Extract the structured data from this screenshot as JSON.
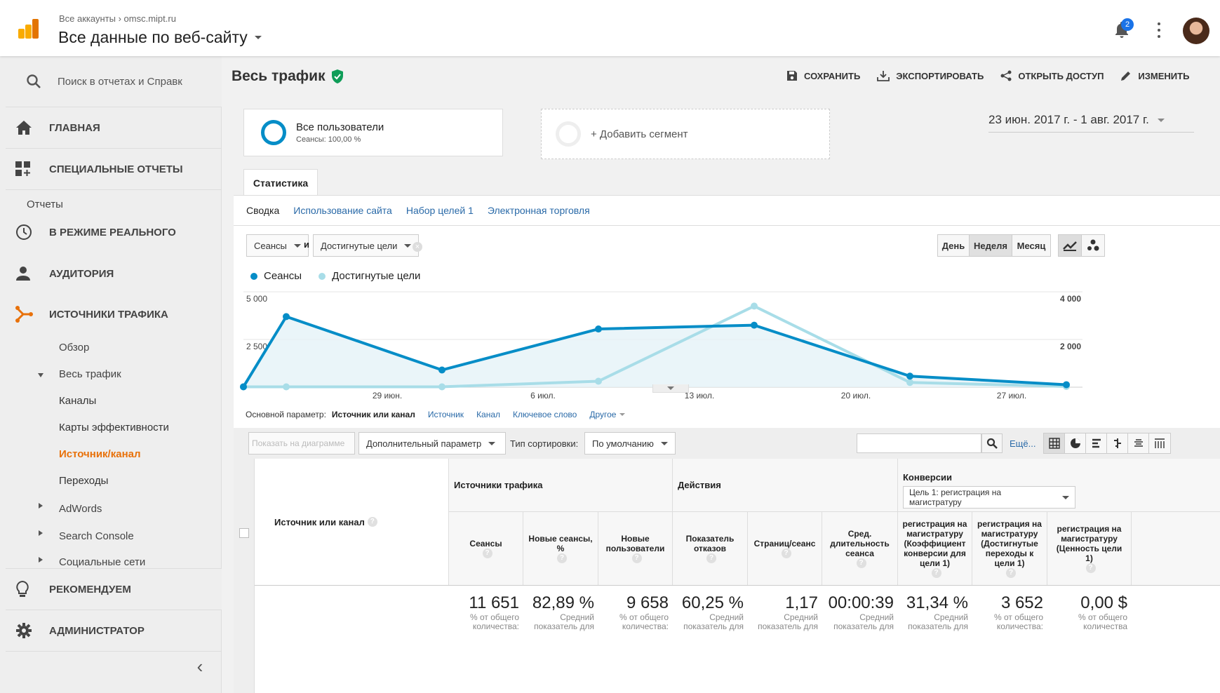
{
  "header": {
    "breadcrumb_root": "Все аккаунты",
    "breadcrumb_property": "omsc.mipt.ru",
    "view_title": "Все данные по веб-сайту",
    "notification_count": "2"
  },
  "sidebar": {
    "search_placeholder": "Поиск в отчетах и Справк",
    "home": "ГЛАВНАЯ",
    "custom_reports": "СПЕЦИАЛЬНЫЕ ОТЧЕТЫ",
    "reports_section": "Отчеты",
    "realtime": "В РЕЖИМЕ РЕАЛЬНОГО",
    "audience": "АУДИТОРИЯ",
    "acquisition": "ИСТОЧНИКИ ТРАФИКА",
    "overview": "Обзор",
    "all_traffic": "Весь трафик",
    "channels": "Каналы",
    "treemaps": "Карты эффективности",
    "source_medium": "Источник/канал",
    "referrals": "Переходы",
    "adwords": "AdWords",
    "search_console": "Search Console",
    "social": "Социальные сети",
    "discover": "РЕКОМЕНДУЕМ",
    "admin": "АДМИНИСТРАТОР",
    "collapse_glyph": "‹"
  },
  "report": {
    "title": "Весь трафик",
    "save": "СОХРАНИТЬ",
    "export": "ЭКСПОРТИРОВАТЬ",
    "share": "ОТКРЫТЬ ДОСТУП",
    "edit": "ИЗМЕНИТЬ",
    "date_range": "23 июн. 2017 г. - 1 авг. 2017 г.",
    "segment_name": "Все пользователи",
    "segment_sub": "Сеансы: 100,00 %",
    "add_segment": "+ Добавить сегмент",
    "tab_explorer": "Статистика",
    "subtabs": [
      "Сводка",
      "Использование сайта",
      "Набор целей 1",
      "Электронная торговля"
    ],
    "metric1": "Сеансы",
    "and_label": "и",
    "metric2": "Достигнутые цели",
    "period_day": "День",
    "period_week": "Неделя",
    "period_month": "Месяц"
  },
  "chart_data": {
    "type": "line",
    "x": [
      "23 июн.",
      "24 июн.",
      "29 июн.",
      "6 июл.",
      "13 июл.",
      "16 июл.",
      "20 июл.",
      "23 июл.",
      "27 июл.",
      "1 авг."
    ],
    "x_tick_labels": [
      "29 июн.",
      "6 июл.",
      "13 июл.",
      "20 июл.",
      "27 июл."
    ],
    "series": [
      {
        "name": "Сеансы",
        "axis": "left",
        "color": "#058dc7",
        "values": [
          20,
          3700,
          900,
          3050,
          null,
          3250,
          null,
          580,
          null,
          130
        ]
      },
      {
        "name": "Достигнутые цели",
        "axis": "right",
        "color": "#a8dde8",
        "values": [
          15,
          15,
          15,
          250,
          null,
          3400,
          null,
          200,
          null,
          30
        ]
      }
    ],
    "left_axis_ticks": [
      "5 000",
      "2 500"
    ],
    "right_axis_ticks": [
      "4 000",
      "2 000"
    ],
    "ylim_left": [
      0,
      5000
    ],
    "ylim_right": [
      0,
      4000
    ]
  },
  "table_controls": {
    "primary_dim_label": "Основной параметр:",
    "dims": [
      "Источник или канал",
      "Источник",
      "Канал",
      "Ключевое слово",
      "Другое"
    ],
    "plot_rows": "Показать на диаграмме",
    "secondary_dim": "Дополнительный параметр",
    "sort_type_label": "Тип сортировки:",
    "sort_default": "По умолчанию",
    "more": "Ещё..."
  },
  "table": {
    "dim_header": "Источник или канал",
    "group_acquisition": "Источники трафика",
    "group_behavior": "Действия",
    "group_conversions": "Конверсии",
    "goal_select": "Цель 1: регистрация на магистратуру",
    "columns": [
      "Сеансы",
      "Новые сеансы, %",
      "Новые пользователи",
      "Показатель отказов",
      "Страниц/сеанс",
      "Сред. длительность сеанса",
      "регистрация на магистратуру (Коэффициент конверсии для цели 1)",
      "регистрация на магистратуру (Достигнутые переходы к цели 1)",
      "регистрация на магистратуру (Ценность цели 1)"
    ],
    "totals": [
      {
        "v": "11 651",
        "s1": "% от общего",
        "s2": "количества:"
      },
      {
        "v": "82,89 %",
        "s1": "Средний",
        "s2": "показатель для"
      },
      {
        "v": "9 658",
        "s1": "% от общего",
        "s2": "количества:"
      },
      {
        "v": "60,25 %",
        "s1": "Средний",
        "s2": "показатель для"
      },
      {
        "v": "1,17",
        "s1": "Средний",
        "s2": "показатель для"
      },
      {
        "v": "00:00:39",
        "s1": "Средний",
        "s2": "показатель для"
      },
      {
        "v": "31,34 %",
        "s1": "Средний",
        "s2": "показатель для"
      },
      {
        "v": "3 652",
        "s1": "% от общего",
        "s2": "количества:"
      },
      {
        "v": "0,00 $",
        "s1": "% от общего",
        "s2": "количества"
      }
    ]
  },
  "colors": {
    "accent_orange": "#e8710a",
    "series1": "#058dc7",
    "series2": "#a8dde8",
    "link": "#2a6aa8"
  }
}
